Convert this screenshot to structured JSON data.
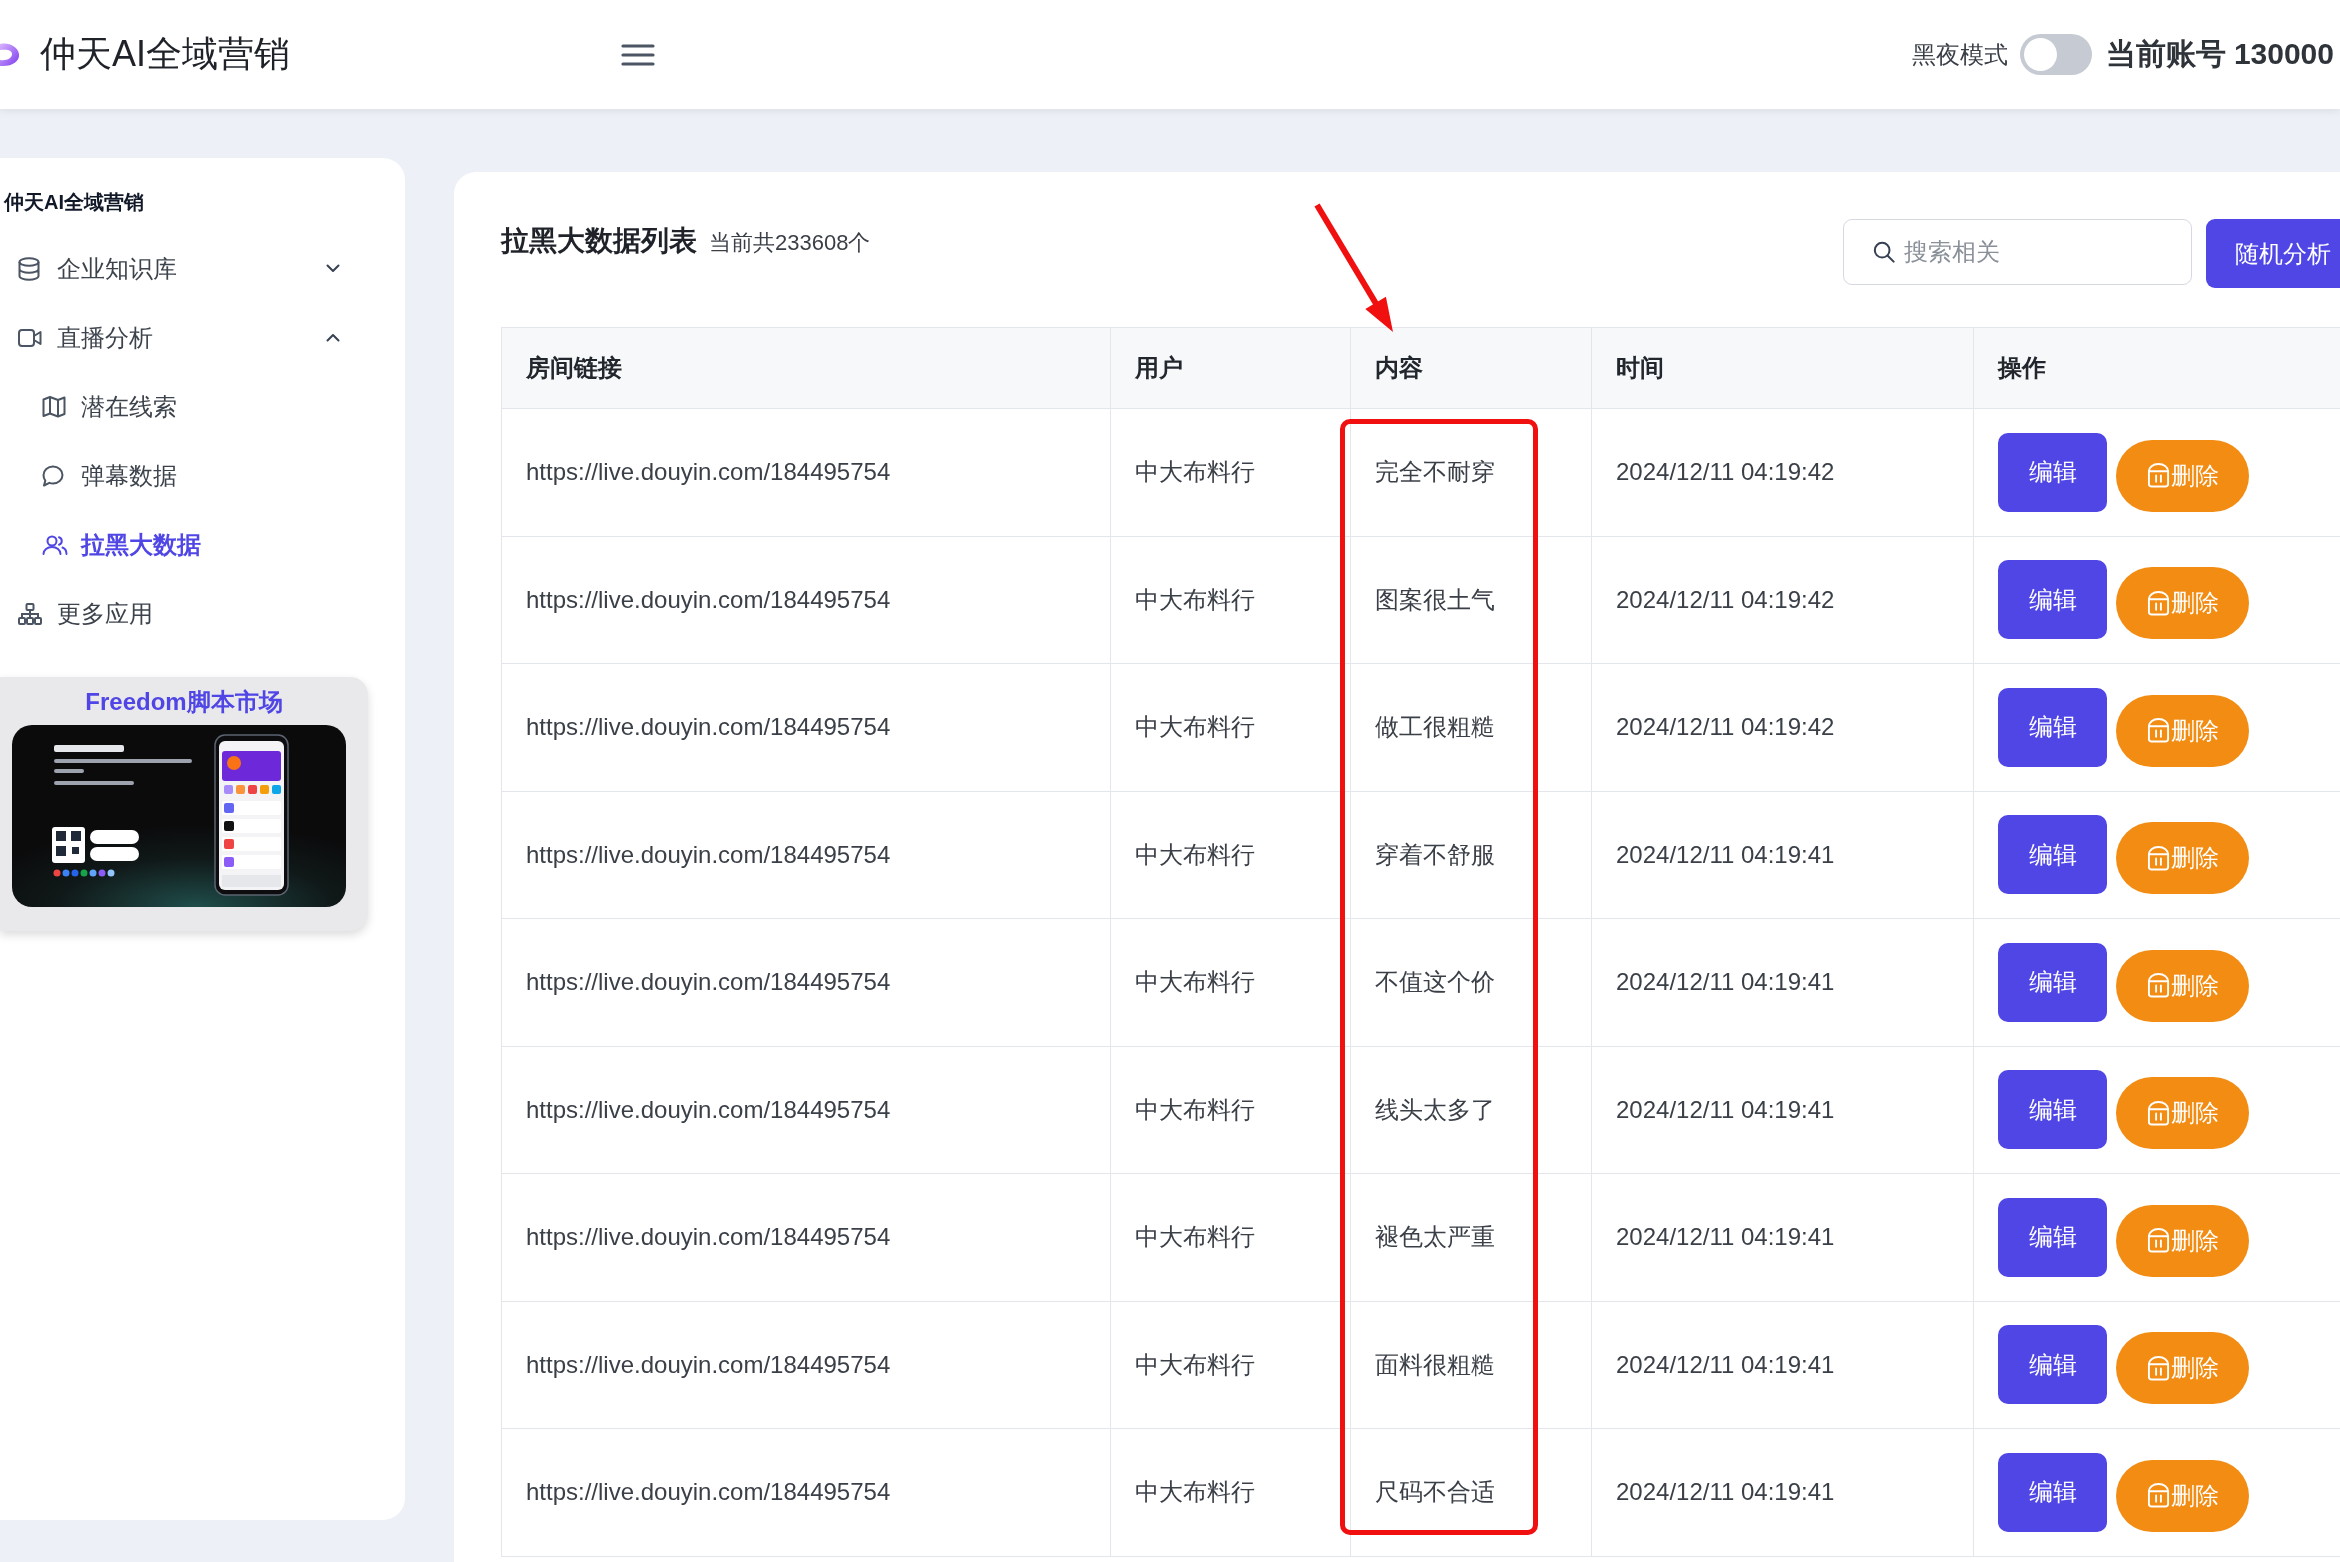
{
  "header": {
    "title": "仲天AI全域营销",
    "dark_mode": {
      "label": "黑夜模式",
      "on": false
    },
    "account": "当前账号 130000"
  },
  "sidebar": {
    "title": "仲天AI全域营销",
    "items": [
      {
        "label": "企业知识库",
        "selected": false,
        "expanded": false
      },
      {
        "label": "直播分析",
        "selected": false,
        "expanded": true,
        "children": [
          {
            "label": "潜在线索",
            "selected": false
          },
          {
            "label": "弹幕数据",
            "selected": false
          },
          {
            "label": "拉黑大数据",
            "selected": true
          }
        ]
      },
      {
        "label": "更多应用",
        "selected": false
      }
    ],
    "promo": {
      "title": "Freedom脚本市场"
    }
  },
  "list": {
    "title": "拉黑大数据列表",
    "count": "当前共233608个",
    "search": {
      "placeholder": "搜索相关"
    },
    "action_button": "随机分析"
  },
  "table": {
    "columns": [
      "房间链接",
      "用户",
      "内容",
      "时间",
      "操作"
    ],
    "rows": [
      {
        "cells": [
          "https://live.douyin.com/184495754",
          "中大布料行",
          "完全不耐穿",
          "2024/12/11 04:19:42"
        ],
        "actions": [
          {
            "kind": "edit",
            "label": "编辑"
          },
          {
            "kind": "delete",
            "label": "删除"
          }
        ]
      },
      {
        "cells": [
          "https://live.douyin.com/184495754",
          "中大布料行",
          "图案很土气",
          "2024/12/11 04:19:42"
        ],
        "actions": [
          {
            "kind": "edit",
            "label": "编辑"
          },
          {
            "kind": "delete",
            "label": "删除"
          }
        ]
      },
      {
        "cells": [
          "https://live.douyin.com/184495754",
          "中大布料行",
          "做工很粗糙",
          "2024/12/11 04:19:42"
        ],
        "actions": [
          {
            "kind": "edit",
            "label": "编辑"
          },
          {
            "kind": "delete",
            "label": "删除"
          }
        ]
      },
      {
        "cells": [
          "https://live.douyin.com/184495754",
          "中大布料行",
          "穿着不舒服",
          "2024/12/11 04:19:41"
        ],
        "actions": [
          {
            "kind": "edit",
            "label": "编辑"
          },
          {
            "kind": "delete",
            "label": "删除"
          }
        ]
      },
      {
        "cells": [
          "https://live.douyin.com/184495754",
          "中大布料行",
          "不值这个价",
          "2024/12/11 04:19:41"
        ],
        "actions": [
          {
            "kind": "edit",
            "label": "编辑"
          },
          {
            "kind": "delete",
            "label": "删除"
          }
        ]
      },
      {
        "cells": [
          "https://live.douyin.com/184495754",
          "中大布料行",
          "线头太多了",
          "2024/12/11 04:19:41"
        ],
        "actions": [
          {
            "kind": "edit",
            "label": "编辑"
          },
          {
            "kind": "delete",
            "label": "删除"
          }
        ]
      },
      {
        "cells": [
          "https://live.douyin.com/184495754",
          "中大布料行",
          "褪色太严重",
          "2024/12/11 04:19:41"
        ],
        "actions": [
          {
            "kind": "edit",
            "label": "编辑"
          },
          {
            "kind": "delete",
            "label": "删除"
          }
        ]
      },
      {
        "cells": [
          "https://live.douyin.com/184495754",
          "中大布料行",
          "面料很粗糙",
          "2024/12/11 04:19:41"
        ],
        "actions": [
          {
            "kind": "edit",
            "label": "编辑"
          },
          {
            "kind": "delete",
            "label": "删除"
          }
        ]
      },
      {
        "cells": [
          "https://live.douyin.com/184495754",
          "中大布料行",
          "尺码不合适",
          "2024/12/11 04:19:41"
        ],
        "actions": [
          {
            "kind": "edit",
            "label": "编辑"
          },
          {
            "kind": "delete",
            "label": "删除"
          }
        ]
      }
    ],
    "annotation": {
      "arrow": true,
      "outline": true
    }
  }
}
